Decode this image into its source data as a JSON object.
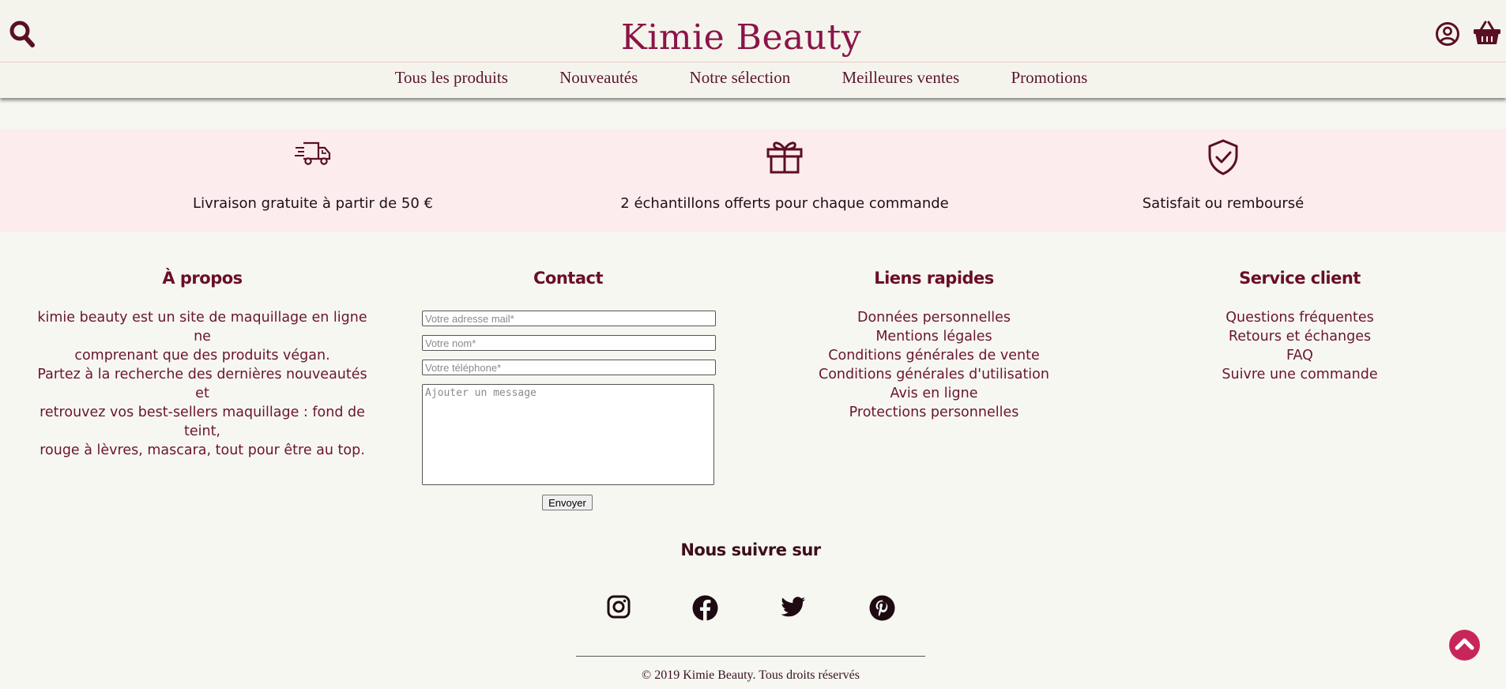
{
  "header": {
    "brand": "Kimie Beauty",
    "icons": {
      "search": "search-icon",
      "account": "user-circle-icon",
      "cart": "basket-icon"
    },
    "nav": [
      "Tous les produits",
      "Nouveautés",
      "Notre sélection",
      "Meilleures ventes",
      "Promotions"
    ]
  },
  "features": [
    {
      "icon": "truck-icon",
      "text": "Livraison gratuite à partir de 50 €"
    },
    {
      "icon": "gift-icon",
      "text": "2 échantillons offerts pour chaque commande"
    },
    {
      "icon": "shield-check-icon",
      "text": "Satisfait ou remboursé"
    }
  ],
  "footer": {
    "about": {
      "title": "À propos",
      "lines": [
        "kimie beauty est un site de maquillage en ligne ne",
        "comprenant que des produits végan.",
        "Partez à la recherche des dernières nouveautés et",
        "retrouvez vos best-sellers maquillage : fond de teint,",
        "rouge à lèvres, mascara, tout pour être au top."
      ]
    },
    "contact": {
      "title": "Contact",
      "email_placeholder": "Votre adresse mail*",
      "name_placeholder": "Votre nom*",
      "phone_placeholder": "Votre téléphone*",
      "message_placeholder": "Ajouter un message",
      "send_label": "Envoyer"
    },
    "quick_links": {
      "title": "Liens rapides",
      "items": [
        "Données personnelles",
        "Mentions légales",
        "Conditions générales de vente",
        "Conditions générales d'utilisation",
        "Avis en ligne",
        "Protections personnelles"
      ]
    },
    "service": {
      "title": "Service client",
      "items": [
        "Questions fréquentes",
        "Retours et échanges",
        "FAQ",
        "Suivre une commande"
      ]
    },
    "follow_title": "Nous suivre sur",
    "social": [
      "instagram-icon",
      "facebook-icon",
      "twitter-icon",
      "pinterest-icon"
    ],
    "copyright": "© 2019 Kimie Beauty. Tous droits réservés"
  },
  "colors": {
    "brand": "#8b1449",
    "header_bg": "#f5f4ec",
    "feature_band": "#fdecee",
    "heading": "#6a0f24",
    "scroll_top": "#c8265a"
  }
}
